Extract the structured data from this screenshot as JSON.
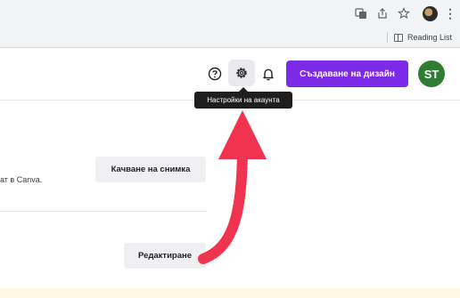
{
  "browser": {
    "bookmarks_bar": {
      "reading_list_label": "Reading List"
    },
    "toolbar_icons": [
      "translate-icon",
      "share-icon",
      "star-icon",
      "profile-avatar",
      "menu-icon"
    ]
  },
  "header": {
    "help_icon": "help-icon",
    "settings_icon": "gear-icon",
    "notifications_icon": "bell-icon",
    "create_design_label": "Създаване на дизайн",
    "avatar_initials": "ST",
    "settings_tooltip": "Настройки на акаунта"
  },
  "content": {
    "profile_photo_text": "ат в Canva.",
    "upload_photo_label": "Качване на снимка",
    "edit_label": "Редактиране"
  },
  "colors": {
    "accent": "#7d2ae8",
    "avatar": "#2e7d32",
    "annotation_arrow": "#f0344f"
  }
}
